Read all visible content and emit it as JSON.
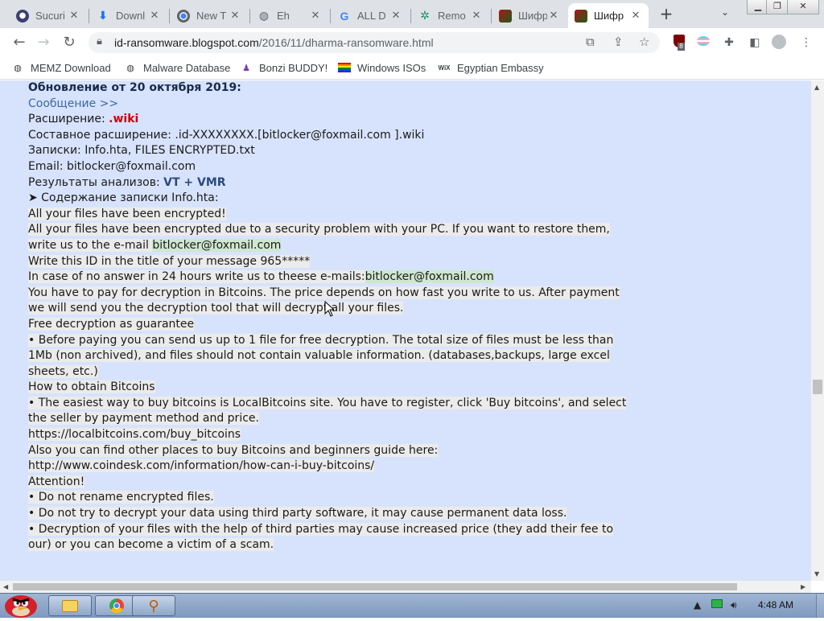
{
  "browser": {
    "tabs": [
      {
        "label": "Sucuri",
        "icon": "sucuri-icon"
      },
      {
        "label": "Downl",
        "icon": "download-icon"
      },
      {
        "label": "New T",
        "icon": "chrome-icon"
      },
      {
        "label": "Eh",
        "icon": "globe-icon"
      },
      {
        "label": "ALL D",
        "icon": "google-icon"
      },
      {
        "label": "Remo",
        "icon": "malwarebytes-icon"
      },
      {
        "label": "Шифр",
        "icon": "blog-icon"
      },
      {
        "label": "Шифр",
        "icon": "blog-icon"
      }
    ],
    "active_tab": 7,
    "url_host": "id-ransomware.blogspot.com",
    "url_path": "/2016/11/dharma-ransomware.html",
    "extension_badge": "8",
    "bookmarks": [
      {
        "label": "MEMZ Download",
        "icon": "globe-icon"
      },
      {
        "label": "Malware Database",
        "icon": "globe-icon"
      },
      {
        "label": "Bonzi BUDDY!",
        "icon": "bonzi-icon"
      },
      {
        "label": "Windows ISOs",
        "icon": "rainbow-flag-icon"
      },
      {
        "label": "Egyptian Embassy",
        "icon": "wix-icon"
      }
    ]
  },
  "content": {
    "update_heading": "Обновление от 20 октября 2019:",
    "message_link": "Сообщение >>",
    "ext_label": "Расширение: ",
    "ext_value": ".wiki",
    "compound_ext": "Составное расширение: .id-XXXXXXXX.[bitlocker@foxmail.com ].wiki",
    "notes": "Записки: Info.hta, FILES ENCRYPTED.txt",
    "email": "Email: bitlocker@foxmail.com",
    "analysis_label": "Результаты анализов: ",
    "analysis_value": "VT + VMR",
    "note_contents": "➤ Содержание записки Info.hta:",
    "note_lines": {
      "l1": "All your files have been encrypted!",
      "l2": "All your files have been encrypted due to a security problem with your PC. If you want to restore them,",
      "l3a": "write us to the e-mail ",
      "l3b": "bitlocker@foxmail.com",
      "l4": "Write this ID in the title of your message 965*****",
      "l5a": "In case of no answer in 24 hours write us to theese e-mails:",
      "l5b": "bitlocker@foxmail.com",
      "l6": "You have to pay for decryption in Bitcoins. The price depends on how fast you write to us. After payment",
      "l7": "we will send you the decryption tool that will decrypt all your files.",
      "l8": "Free decryption as guarantee",
      "l9": "• Before paying you can send us up to 1 file for free decryption. The total size of files must be less than",
      "l10": "1Mb (non archived), and files should not contain valuable information. (databases,backups, large excel",
      "l11": "sheets, etc.)",
      "l12": "How to obtain Bitcoins",
      "l13": "• The easiest way to buy bitcoins is LocalBitcoins site. You have to register, click 'Buy bitcoins', and select",
      "l14": "the seller by payment method and price.",
      "l15": "https://localbitcoins.com/buy_bitcoins",
      "l16": "Also you can find other places to buy Bitcoins and beginners guide here:",
      "l17": "http://www.coindesk.com/information/how-can-i-buy-bitcoins/",
      "l18": "Attention!",
      "l19": "• Do not rename encrypted files.",
      "l20": "• Do not try to decrypt your data using third party software, it may cause permanent data loss.",
      "l21": "• Decryption of your files with the help of third parties may cause increased price (they add their fee to",
      "l22": "our) or you can become a victim of a scam."
    }
  },
  "taskbar": {
    "clock": "4:48 AM"
  },
  "colors": {
    "page_bg": "#d7e3fd",
    "highlight": "#ebebeb",
    "email_highlight": "#cfe7cf",
    "ext_red": "#cc0000"
  }
}
